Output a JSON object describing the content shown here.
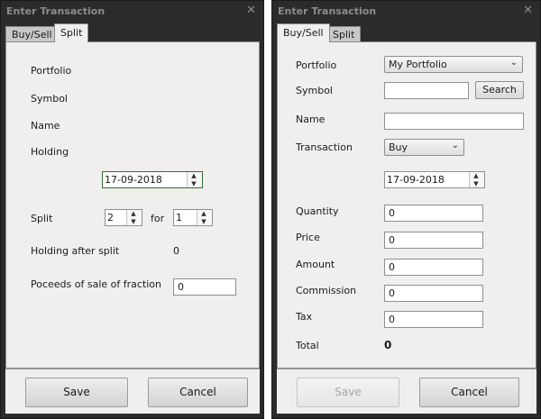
{
  "left": {
    "title": "Enter Transaction",
    "tabs": [
      "Buy/Sell",
      "Split"
    ],
    "labels": {
      "portfolio": "Portfolio",
      "symbol": "Symbol",
      "name": "Name",
      "holding": "Holding",
      "split": "Split",
      "for": "for",
      "holding_after": "Holding after split",
      "proceeds": "Poceeds of sale of fraction"
    },
    "date": "17-09-2018",
    "split_from": "2",
    "split_to": "1",
    "holding_after_value": "0",
    "proceeds_value": "0",
    "save": "Save",
    "cancel": "Cancel"
  },
  "right": {
    "title": "Enter Transaction",
    "tabs": [
      "Buy/Sell",
      "Split"
    ],
    "labels": {
      "portfolio": "Portfolio",
      "symbol": "Symbol",
      "name": "Name",
      "transaction": "Transaction",
      "quantity": "Quantity",
      "price": "Price",
      "amount": "Amount",
      "commission": "Commission",
      "tax": "Tax",
      "total": "Total"
    },
    "portfolio_value": "My Portfolio",
    "search": "Search",
    "transaction_value": "Buy",
    "date": "17-09-2018",
    "quantity_value": "0",
    "price_value": "0",
    "amount_value": "0",
    "commission_value": "0",
    "tax_value": "0",
    "total_value": "0",
    "save": "Save",
    "cancel": "Cancel"
  }
}
